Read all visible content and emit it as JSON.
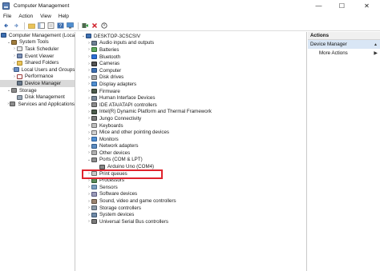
{
  "window": {
    "title": "Computer Management"
  },
  "window_buttons": {
    "minimize": "—",
    "maximize": "☐",
    "close": "✕"
  },
  "menu": [
    "File",
    "Action",
    "View",
    "Help"
  ],
  "left_tree": [
    {
      "label": "Computer Management (Local)",
      "icon": "computer-icon",
      "icon_class": "i-computer",
      "indent": 0,
      "expander": ""
    },
    {
      "label": "System Tools",
      "icon": "tools-icon",
      "icon_class": "i-tools",
      "indent": 1,
      "expander": "⌄"
    },
    {
      "label": "Task Scheduler",
      "icon": "clock-icon",
      "icon_class": "i-clock",
      "indent": 2,
      "expander": "›"
    },
    {
      "label": "Event Viewer",
      "icon": "event-viewer-icon",
      "icon_class": "i-event",
      "indent": 2,
      "expander": "›"
    },
    {
      "label": "Shared Folders",
      "icon": "folder-icon",
      "icon_class": "i-folder",
      "indent": 2,
      "expander": "›"
    },
    {
      "label": "Local Users and Groups",
      "icon": "users-icon",
      "icon_class": "i-users",
      "indent": 2,
      "expander": "›"
    },
    {
      "label": "Performance",
      "icon": "performance-icon",
      "icon_class": "i-perf",
      "indent": 2,
      "expander": "›"
    },
    {
      "label": "Device Manager",
      "icon": "device-manager-icon",
      "icon_class": "i-devmgr",
      "indent": 2,
      "expander": "",
      "selected": true
    },
    {
      "label": "Storage",
      "icon": "storage-icon",
      "icon_class": "i-storage",
      "indent": 1,
      "expander": "⌄"
    },
    {
      "label": "Disk Management",
      "icon": "disk-icon",
      "icon_class": "i-disk",
      "indent": 2,
      "expander": ""
    },
    {
      "label": "Services and Applications",
      "icon": "services-icon",
      "icon_class": "i-services",
      "indent": 1,
      "expander": "›"
    }
  ],
  "device_tree": {
    "root": {
      "label": "DESKTOP-3CSCSIV",
      "icon": "computer-icon",
      "icon_class": "i-computer",
      "expander": "⌄"
    },
    "categories": [
      {
        "label": "Audio inputs and outputs",
        "icon": "audio-icon",
        "icon_class": "i-audio",
        "expander": "›"
      },
      {
        "label": "Batteries",
        "icon": "battery-icon",
        "icon_class": "i-battery",
        "expander": "›"
      },
      {
        "label": "Bluetooth",
        "icon": "bluetooth-icon",
        "icon_class": "i-bt",
        "expander": "›"
      },
      {
        "label": "Cameras",
        "icon": "camera-icon",
        "icon_class": "i-camera",
        "expander": "›"
      },
      {
        "label": "Computer",
        "icon": "computer-icon",
        "icon_class": "i-computer",
        "expander": "›"
      },
      {
        "label": "Disk drives",
        "icon": "disk-drive-icon",
        "icon_class": "i-disk2",
        "expander": "›"
      },
      {
        "label": "Display adapters",
        "icon": "display-adapter-icon",
        "icon_class": "i-display",
        "expander": "›"
      },
      {
        "label": "Firmware",
        "icon": "firmware-icon",
        "icon_class": "i-chip",
        "expander": "›"
      },
      {
        "label": "Human Interface Devices",
        "icon": "hid-icon",
        "icon_class": "i-hid",
        "expander": "›"
      },
      {
        "label": "IDE ATA/ATAPI controllers",
        "icon": "ide-icon",
        "icon_class": "i-ide",
        "expander": "›"
      },
      {
        "label": "Intel(R) Dynamic Platform and Thermal Framework",
        "icon": "chip-icon",
        "icon_class": "i-chip",
        "expander": "›"
      },
      {
        "label": "Jungo Connectivity",
        "icon": "jungo-icon",
        "icon_class": "i-usb",
        "expander": "›"
      },
      {
        "label": "Keyboards",
        "icon": "keyboard-icon",
        "icon_class": "i-keyboard",
        "expander": "›"
      },
      {
        "label": "Mice and other pointing devices",
        "icon": "mouse-icon",
        "icon_class": "i-mouse",
        "expander": "›"
      },
      {
        "label": "Monitors",
        "icon": "monitor-icon",
        "icon_class": "i-monitor",
        "expander": "›"
      },
      {
        "label": "Network adapters",
        "icon": "network-icon",
        "icon_class": "i-net",
        "expander": "›"
      },
      {
        "label": "Other devices",
        "icon": "other-devices-icon",
        "icon_class": "i-other",
        "expander": "›"
      },
      {
        "label": "Ports (COM & LPT)",
        "icon": "ports-icon",
        "icon_class": "i-ports",
        "expander": "⌄"
      },
      {
        "label": "Arduino Uno (COM4)",
        "icon": "arduino-port-icon",
        "icon_class": "i-arduino",
        "expander": "",
        "child": true
      },
      {
        "label": "Print queues",
        "icon": "printer-icon",
        "icon_class": "i-print",
        "expander": "›"
      },
      {
        "label": "Processors",
        "icon": "processor-icon",
        "icon_class": "i-cpu",
        "expander": "›"
      },
      {
        "label": "Sensors",
        "icon": "sensor-icon",
        "icon_class": "i-sensor",
        "expander": "›"
      },
      {
        "label": "Software devices",
        "icon": "software-device-icon",
        "icon_class": "i-soft",
        "expander": "›"
      },
      {
        "label": "Sound, video and game controllers",
        "icon": "sound-icon",
        "icon_class": "i-sound",
        "expander": "›"
      },
      {
        "label": "Storage controllers",
        "icon": "storage-controller-icon",
        "icon_class": "i-storctl",
        "expander": "›"
      },
      {
        "label": "System devices",
        "icon": "system-device-icon",
        "icon_class": "i-sysdev",
        "expander": "›"
      },
      {
        "label": "Universal Serial Bus controllers",
        "icon": "usb-icon",
        "icon_class": "i-usb",
        "expander": "›"
      }
    ]
  },
  "actions": {
    "header": "Actions",
    "section": "Device Manager",
    "section_caret": "▲",
    "items": [
      {
        "label": "More Actions",
        "arrow": "▶"
      }
    ]
  },
  "colors": {
    "highlight_border": "#e0232d",
    "selection": "#d9d9d9",
    "actions_section": "#d9e6f5"
  }
}
